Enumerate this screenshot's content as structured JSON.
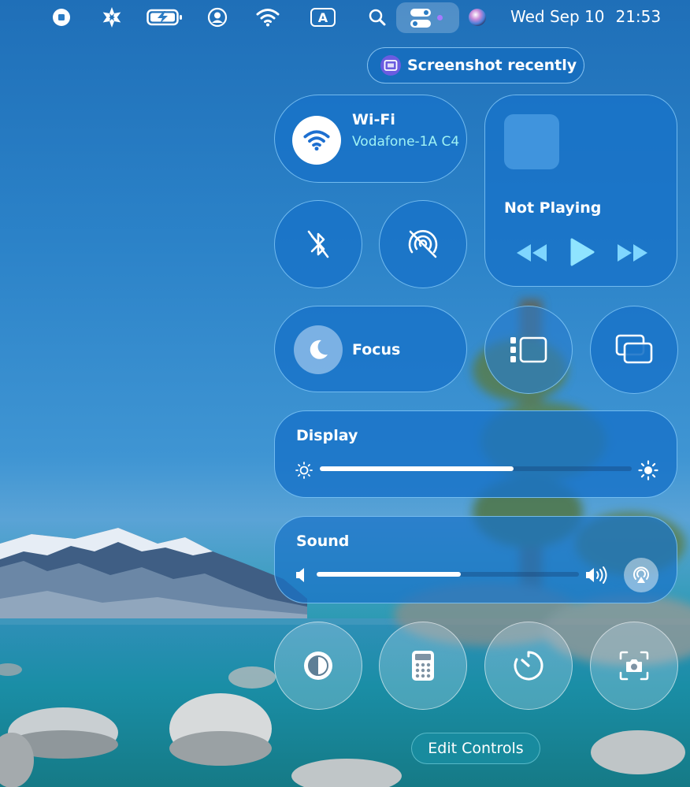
{
  "menubar": {
    "date": "Wed Sep 10",
    "time": "21:53",
    "icons": [
      "stop-icon",
      "snowflake-icon",
      "battery-icon",
      "user-icon",
      "wifi-icon",
      "input-source-icon",
      "search-icon",
      "control-center-icon",
      "siri-icon"
    ],
    "input_source_label": "A"
  },
  "notification": {
    "text": "Screenshot recently"
  },
  "wifi": {
    "title": "Wi-Fi",
    "network": "Vodafone-1A C4"
  },
  "now_playing": {
    "title": "Not Playing"
  },
  "focus": {
    "label": "Focus"
  },
  "display": {
    "title": "Display",
    "brightness": 0.62
  },
  "sound": {
    "title": "Sound",
    "volume": 0.55
  },
  "edit_controls": {
    "label": "Edit Controls"
  },
  "colors": {
    "accent": "#1973c8",
    "wifi_network": "#9ff2f4",
    "edit_button": "#198ca0"
  }
}
